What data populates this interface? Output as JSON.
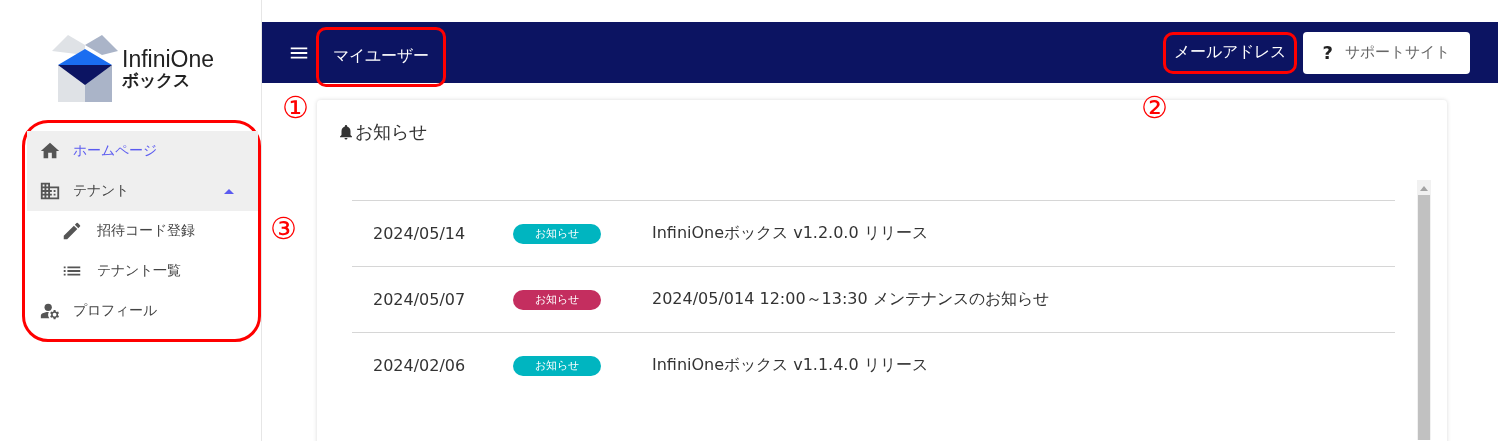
{
  "logo": {
    "name": "InfiniOne",
    "subtitle": "ボックス"
  },
  "sidebar": {
    "items": [
      {
        "label": "ホームページ",
        "selected": true
      },
      {
        "label": "テナント",
        "selected": false,
        "expanded": true,
        "children": [
          {
            "label": "招待コード登録",
            "selected": false
          },
          {
            "label": "テナント一覧",
            "selected": false
          }
        ]
      },
      {
        "label": "プロフィール",
        "selected": false
      }
    ]
  },
  "header": {
    "title": "マイユーザー",
    "email": "メールアドレス",
    "support_button": {
      "icon": "?",
      "label": "サポートサイト"
    }
  },
  "notices": {
    "title": "お知らせ",
    "rows": [
      {
        "date": "2024/05/14",
        "tag": "お知らせ",
        "color": "#00b5c0",
        "text": "InfiniOneボックス v1.2.0.0 リリース"
      },
      {
        "date": "2024/05/07",
        "tag": "お知らせ",
        "color": "#c42e5f",
        "text": "2024/05/014 12:00～13:30 メンテナンスのお知らせ"
      },
      {
        "date": "2024/02/06",
        "tag": "お知らせ",
        "color": "#00b5c0",
        "text": "InfiniOneボックス v1.1.4.0 リリース"
      }
    ]
  },
  "annotations": [
    {
      "label": "①",
      "kind": "title"
    },
    {
      "label": "②",
      "kind": "email"
    },
    {
      "label": "③",
      "kind": "sidebar"
    }
  ]
}
